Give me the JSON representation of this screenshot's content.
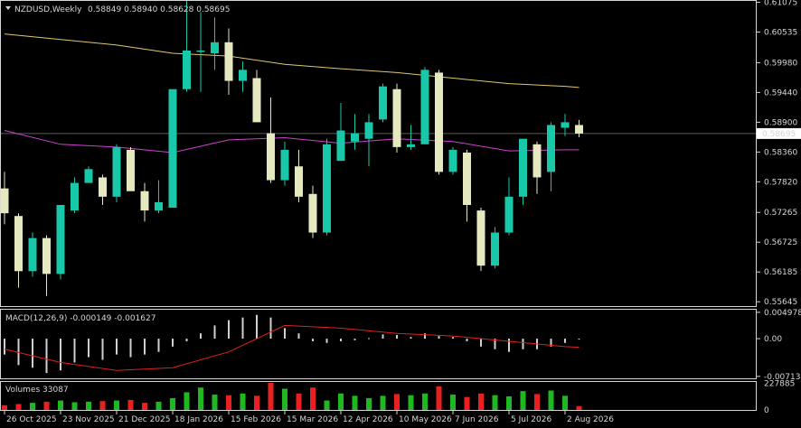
{
  "window": {
    "symbol": "NZDUSD,Weekly",
    "ohlc": "0.58849 0.58940 0.58628 0.58695"
  },
  "colors": {
    "background": "#000000",
    "axis": "#d6d6d6",
    "bull": "#18c8a8",
    "bear": "#e6e8c0",
    "ma_slow": "#e0c870",
    "ma_fast": "#d040d0",
    "macd_bar": "#d0d0d0",
    "macd_signal": "#e02020",
    "vol_up": "#20b820",
    "vol_down": "#e82020",
    "price_tag_bg": "#ffffff",
    "price_tag_fg": "#000000"
  },
  "chart_data": {
    "type": "candlestick",
    "price_axis": {
      "ticks": [
        "0.61075",
        "0.60535",
        "0.59980",
        "0.59440",
        "0.58900",
        "0.58360",
        "0.57820",
        "0.57265",
        "0.56725",
        "0.56185",
        "0.55645"
      ],
      "ylim": [
        0.5555,
        0.611
      ],
      "current_price": "0.58695",
      "current_value": 0.58695
    },
    "x_ticks": [
      "26 Oct 2025",
      "23 Nov 2025",
      "21 Dec 2025",
      "18 Jan 2026",
      "15 Feb 2026",
      "15 Mar 2026",
      "12 Apr 2026",
      "10 May 2026",
      "7 Jun 2026",
      "5 Jul 2026",
      "2 Aug 2026"
    ],
    "candles": [
      {
        "o": 0.577,
        "h": 0.58,
        "l": 0.5705,
        "c": 0.5725
      },
      {
        "o": 0.572,
        "h": 0.5725,
        "l": 0.559,
        "c": 0.562
      },
      {
        "o": 0.562,
        "h": 0.569,
        "l": 0.561,
        "c": 0.568
      },
      {
        "o": 0.568,
        "h": 0.5685,
        "l": 0.5575,
        "c": 0.5615
      },
      {
        "o": 0.5615,
        "h": 0.574,
        "l": 0.5605,
        "c": 0.574
      },
      {
        "o": 0.573,
        "h": 0.579,
        "l": 0.5725,
        "c": 0.578
      },
      {
        "o": 0.578,
        "h": 0.581,
        "l": 0.578,
        "c": 0.5805
      },
      {
        "o": 0.579,
        "h": 0.5795,
        "l": 0.574,
        "c": 0.5755
      },
      {
        "o": 0.5755,
        "h": 0.585,
        "l": 0.5745,
        "c": 0.5845
      },
      {
        "o": 0.584,
        "h": 0.5845,
        "l": 0.5775,
        "c": 0.5765
      },
      {
        "o": 0.5765,
        "h": 0.578,
        "l": 0.571,
        "c": 0.573
      },
      {
        "o": 0.573,
        "h": 0.5785,
        "l": 0.5725,
        "c": 0.5745
      },
      {
        "o": 0.5735,
        "h": 0.595,
        "l": 0.5735,
        "c": 0.595
      },
      {
        "o": 0.595,
        "h": 0.611,
        "l": 0.5945,
        "c": 0.602
      },
      {
        "o": 0.602,
        "h": 0.609,
        "l": 0.5945,
        "c": 0.602
      },
      {
        "o": 0.6015,
        "h": 0.608,
        "l": 0.5985,
        "c": 0.6035
      },
      {
        "o": 0.6035,
        "h": 0.606,
        "l": 0.594,
        "c": 0.5965
      },
      {
        "o": 0.5965,
        "h": 0.6,
        "l": 0.5945,
        "c": 0.5985
      },
      {
        "o": 0.597,
        "h": 0.5985,
        "l": 0.589,
        "c": 0.589
      },
      {
        "o": 0.587,
        "h": 0.5935,
        "l": 0.578,
        "c": 0.5785
      },
      {
        "o": 0.5785,
        "h": 0.5855,
        "l": 0.5775,
        "c": 0.584
      },
      {
        "o": 0.581,
        "h": 0.584,
        "l": 0.5745,
        "c": 0.5755
      },
      {
        "o": 0.576,
        "h": 0.5775,
        "l": 0.568,
        "c": 0.569
      },
      {
        "o": 0.569,
        "h": 0.586,
        "l": 0.5685,
        "c": 0.585
      },
      {
        "o": 0.582,
        "h": 0.5925,
        "l": 0.582,
        "c": 0.5875
      },
      {
        "o": 0.5855,
        "h": 0.5905,
        "l": 0.584,
        "c": 0.587
      },
      {
        "o": 0.586,
        "h": 0.5905,
        "l": 0.581,
        "c": 0.589
      },
      {
        "o": 0.5895,
        "h": 0.596,
        "l": 0.589,
        "c": 0.5955
      },
      {
        "o": 0.595,
        "h": 0.596,
        "l": 0.5835,
        "c": 0.5845
      },
      {
        "o": 0.5845,
        "h": 0.5885,
        "l": 0.584,
        "c": 0.585
      },
      {
        "o": 0.585,
        "h": 0.599,
        "l": 0.585,
        "c": 0.5985
      },
      {
        "o": 0.598,
        "h": 0.5985,
        "l": 0.5795,
        "c": 0.58
      },
      {
        "o": 0.58,
        "h": 0.5845,
        "l": 0.5795,
        "c": 0.584
      },
      {
        "o": 0.5835,
        "h": 0.584,
        "l": 0.571,
        "c": 0.574
      },
      {
        "o": 0.573,
        "h": 0.5735,
        "l": 0.562,
        "c": 0.563
      },
      {
        "o": 0.563,
        "h": 0.57,
        "l": 0.5625,
        "c": 0.569
      },
      {
        "o": 0.569,
        "h": 0.579,
        "l": 0.5685,
        "c": 0.5755
      },
      {
        "o": 0.5755,
        "h": 0.586,
        "l": 0.574,
        "c": 0.586
      },
      {
        "o": 0.585,
        "h": 0.5855,
        "l": 0.576,
        "c": 0.579
      },
      {
        "o": 0.58,
        "h": 0.589,
        "l": 0.5765,
        "c": 0.5885
      },
      {
        "o": 0.588,
        "h": 0.5905,
        "l": 0.5865,
        "c": 0.589
      },
      {
        "o": 0.5885,
        "h": 0.5894,
        "l": 0.58628,
        "c": 0.58695
      }
    ],
    "ma_slow": {
      "i": [
        0,
        4,
        8,
        12,
        16,
        20,
        24,
        28,
        32,
        36,
        40,
        41
      ],
      "v": [
        0.605,
        0.604,
        0.603,
        0.6015,
        0.601,
        0.5995,
        0.5987,
        0.598,
        0.597,
        0.596,
        0.5955,
        0.5953
      ]
    },
    "ma_fast": {
      "i": [
        0,
        4,
        8,
        12,
        16,
        20,
        24,
        28,
        32,
        36,
        40,
        41
      ],
      "v": [
        0.5875,
        0.585,
        0.5845,
        0.5835,
        0.5858,
        0.5862,
        0.5852,
        0.586,
        0.5855,
        0.5838,
        0.584,
        0.584
      ]
    },
    "macd": {
      "label": "MACD(12,26,9) -0.000149 -0.001627",
      "ticks": [
        "0.004978",
        "0.00",
        "-0.007131"
      ],
      "ylim": [
        -0.0075,
        0.0053
      ],
      "hist": [
        -0.003,
        -0.005,
        -0.0055,
        -0.0065,
        -0.006,
        -0.0045,
        -0.0035,
        -0.004,
        -0.003,
        -0.0035,
        -0.003,
        -0.0025,
        -0.0015,
        -0.0005,
        0.001,
        0.0025,
        0.0035,
        0.004,
        0.0045,
        0.004,
        0.002,
        0.001,
        -0.0005,
        -0.0008,
        -0.0005,
        -0.0003,
        0.0001,
        0.0008,
        0.0007,
        0.0003,
        0.001,
        0.0005,
        0.0003,
        -0.0005,
        -0.0015,
        -0.002,
        -0.0025,
        -0.002,
        -0.002,
        -0.0015,
        -0.0008,
        -0.000149
      ],
      "signal": {
        "i": [
          0,
          4,
          8,
          12,
          16,
          20,
          24,
          28,
          32,
          36,
          40,
          41
        ],
        "v": [
          -0.002,
          -0.0045,
          -0.006,
          -0.0055,
          -0.0025,
          0.0025,
          0.002,
          0.001,
          0.0005,
          -0.0005,
          -0.0015,
          -0.001627
        ]
      }
    },
    "volumes": {
      "label": "Volumes 33087",
      "ticks": [
        "227885",
        "0"
      ],
      "ylim": [
        0,
        230000
      ],
      "values": [
        40000,
        50000,
        60000,
        70000,
        80000,
        65000,
        70000,
        75000,
        80000,
        85000,
        60000,
        70000,
        100000,
        150000,
        190000,
        130000,
        125000,
        140000,
        120000,
        230000,
        180000,
        140000,
        190000,
        80000,
        140000,
        120000,
        100000,
        120000,
        135000,
        125000,
        140000,
        200000,
        130000,
        110000,
        140000,
        125000,
        115000,
        160000,
        135000,
        165000,
        120000,
        33087
      ]
    }
  }
}
